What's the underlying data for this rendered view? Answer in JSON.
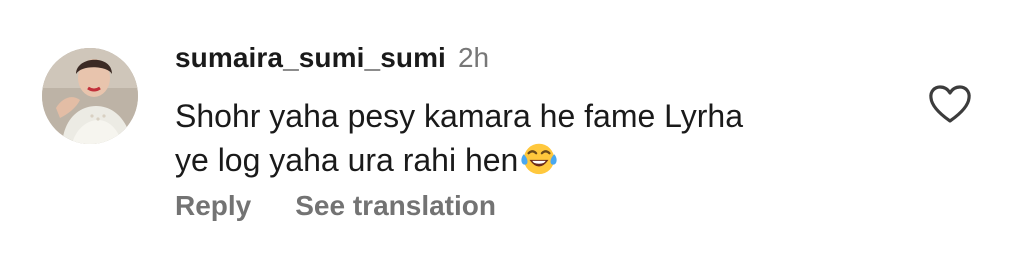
{
  "comment": {
    "username": "sumaira_sumi_sumi",
    "timestamp": "2h",
    "text_line1": "Shohr yaha pesy kamara he fame Lyrha",
    "text_line2": "ye log yaha ura rahi hen",
    "emoji": "face-with-tears-of-joy",
    "avatar": "profile-photo"
  },
  "actions": {
    "reply_label": "Reply",
    "translate_label": "See translation",
    "like_icon": "heart-outline-icon"
  },
  "colors": {
    "username": "#1a1a1a",
    "muted": "#777777",
    "action": "#737373",
    "emoji_face": "#FFC83D",
    "tears": "#4AA8F0"
  }
}
